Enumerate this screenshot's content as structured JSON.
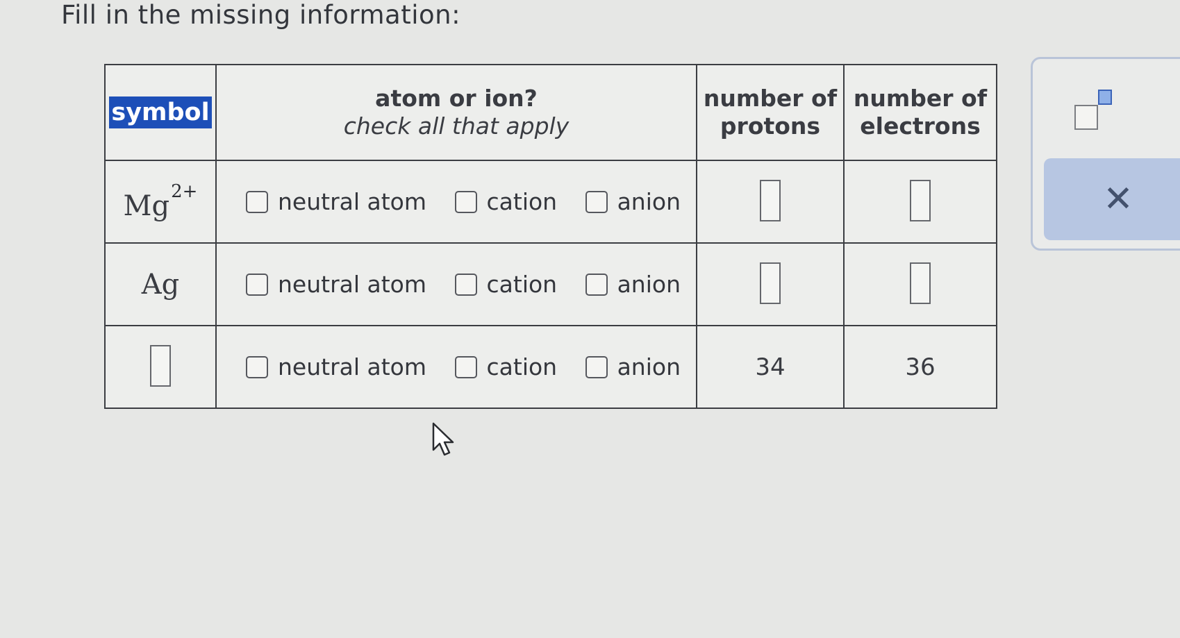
{
  "prompt": "Fill in the missing information:",
  "table": {
    "headers": {
      "symbol": "symbol",
      "atom_or_ion": "atom or ion?",
      "atom_or_ion_hint": "check all that apply",
      "protons": "number of protons",
      "electrons": "number of electrons"
    },
    "rows": [
      {
        "symbol": "Mg",
        "charge": "2+",
        "options": [
          "neutral atom",
          "cation",
          "anion"
        ],
        "protons": "",
        "electrons": ""
      },
      {
        "symbol": "Ag",
        "charge": "",
        "options": [
          "neutral atom",
          "cation",
          "anion"
        ],
        "protons": "",
        "electrons": ""
      },
      {
        "symbol": "",
        "charge": "",
        "options": [
          "neutral atom",
          "cation",
          "anion"
        ],
        "protons": "34",
        "electrons": "36"
      }
    ]
  },
  "tools": {
    "superscript_icon": "superscript-icon",
    "clear_icon_glyph": "✕"
  },
  "colors": {
    "symbol_header_highlight": "#1d4fb8",
    "clear_button": "#b7c6e2"
  }
}
